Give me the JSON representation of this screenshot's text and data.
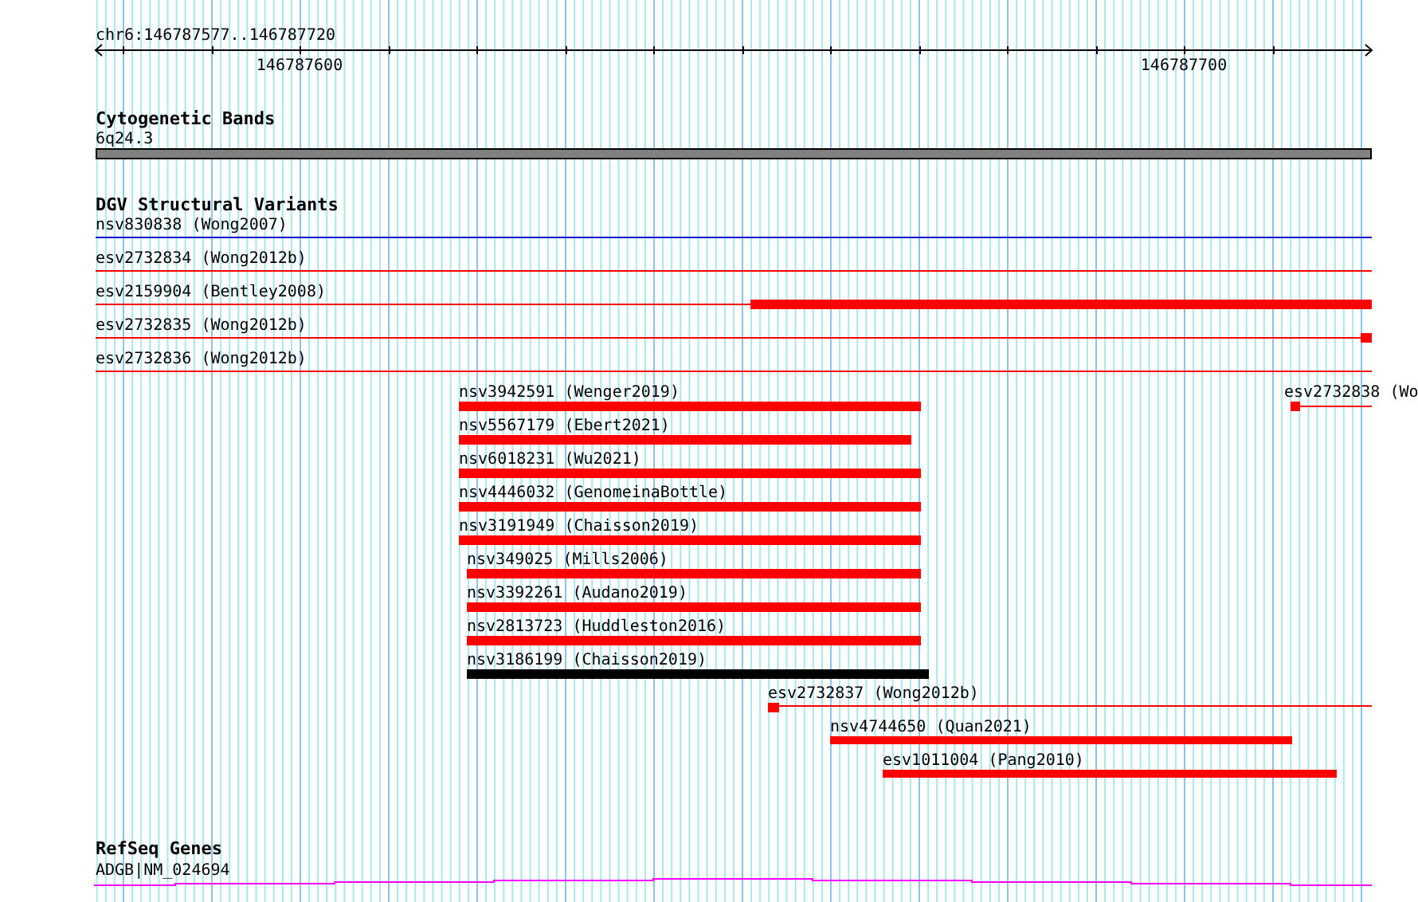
{
  "ruler": {
    "location": "chr6:146787577..146787720",
    "ticks": [
      "146787600",
      "146787700"
    ]
  },
  "tracks": [
    {
      "title": "Cytogenetic Bands",
      "kind": "bands",
      "features": [
        {
          "label": "6q24.3"
        }
      ]
    },
    {
      "title": "DGV Structural Variants",
      "kind": "variants",
      "features": [
        {
          "label": "nsv830838 (Wong2007)",
          "color": "#0000cc"
        },
        {
          "label": "esv2732834 (Wong2012b)",
          "color": "#ff0000"
        },
        {
          "label": "esv2159904 (Bentley2008)",
          "color": "#ff0000"
        },
        {
          "label": "esv2732835 (Wong2012b)",
          "color": "#ff0000"
        },
        {
          "label": "esv2732836 (Wong2012b)",
          "color": "#ff0000"
        },
        {
          "label": "nsv3942591 (Wenger2019)",
          "color": "#ff0000"
        },
        {
          "label": "nsv5567179 (Ebert2021)",
          "color": "#ff0000"
        },
        {
          "label": "nsv6018231 (Wu2021)",
          "color": "#ff0000"
        },
        {
          "label": "nsv4446032 (GenomeinaBottle)",
          "color": "#ff0000"
        },
        {
          "label": "nsv3191949 (Chaisson2019)",
          "color": "#ff0000"
        },
        {
          "label": "nsv349025 (Mills2006)",
          "color": "#ff0000"
        },
        {
          "label": "nsv3392261 (Audano2019)",
          "color": "#ff0000"
        },
        {
          "label": "nsv2813723 (Huddleston2016)",
          "color": "#ff0000"
        },
        {
          "label": "nsv3186199 (Chaisson2019)",
          "color": "#000000"
        },
        {
          "label": "esv2732838 (Wo",
          "color": "#ff0000"
        },
        {
          "label": "esv2732837 (Wong2012b)",
          "color": "#ff0000"
        },
        {
          "label": "nsv4744650 (Quan2021)",
          "color": "#ff0000"
        },
        {
          "label": "esv1011004 (Pang2010)",
          "color": "#ff0000"
        }
      ]
    },
    {
      "title": "RefSeq Genes",
      "kind": "genes",
      "features": [
        {
          "label": "ADGB|NM_024694"
        }
      ]
    }
  ]
}
